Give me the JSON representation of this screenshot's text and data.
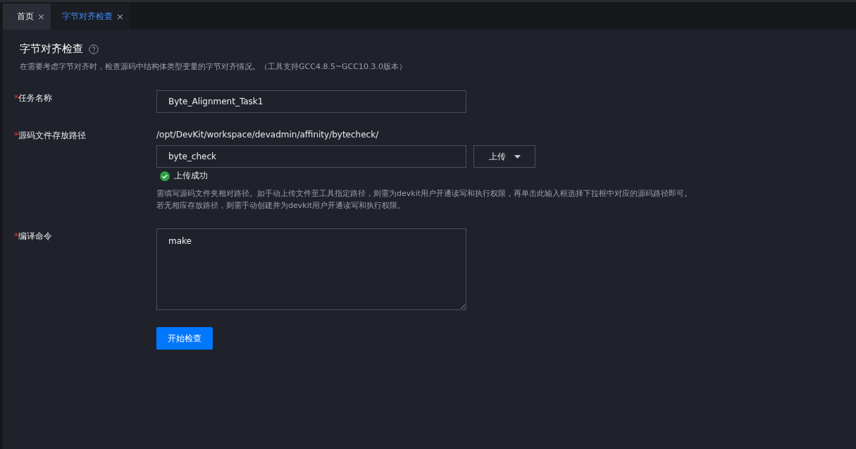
{
  "tabs": [
    {
      "label": "首页",
      "close": "×",
      "selected": false
    },
    {
      "label": "字节对齐检查",
      "close": "×",
      "selected": true
    }
  ],
  "page": {
    "title": "字节对齐检查",
    "description": "在需要考虑字节对齐时，检查源码中结构体类型变量的字节对齐情况。（工具支持GCC4.8.5~GCC10.3.0版本）"
  },
  "fields": [
    {
      "kind": "text",
      "required_mark": "*",
      "label": "任务名称",
      "value": "Byte_Alignment_Task1"
    },
    {
      "kind": "path",
      "required_mark": "*",
      "label": "源码文件存放路径",
      "prefix": "/opt/DevKit/workspace/devadmin/affinity/bytecheck/",
      "value": "byte_check",
      "upload_button": "上传",
      "status": "上传成功",
      "hint": [
        "需填写源码文件夹相对路径。如手动上传文件至工具指定路径，则需为devkit用户开通读写和执行权限，再单击此输入框选择下拉框中对应的源码路径即可。",
        "若无相应存放路径，则需手动创建并为devkit用户开通读写和执行权限。"
      ]
    },
    {
      "kind": "textarea",
      "required_mark": "*",
      "label": "编译命令",
      "value": "make"
    }
  ],
  "submit_button": "开始检查"
}
